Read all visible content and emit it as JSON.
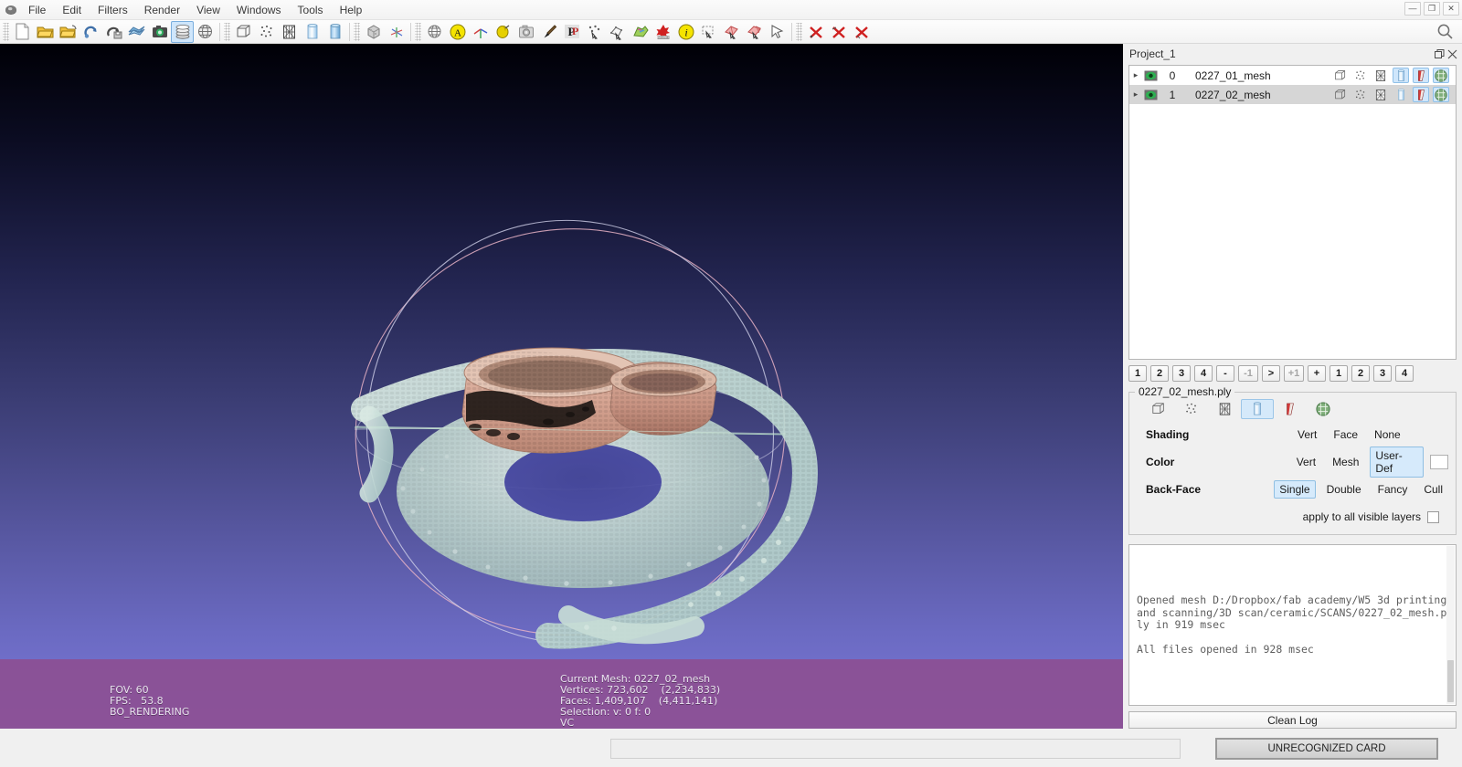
{
  "window": {
    "minimize_label": "—",
    "restore_label": "❐",
    "close_label": "✕"
  },
  "menubar": {
    "app_icon": "meshlab-logo-icon",
    "items": [
      {
        "label": "File"
      },
      {
        "label": "Edit"
      },
      {
        "label": "Filters"
      },
      {
        "label": "Render"
      },
      {
        "label": "View"
      },
      {
        "label": "Windows"
      },
      {
        "label": "Tools"
      },
      {
        "label": "Help"
      }
    ]
  },
  "toolbar": {
    "groups": [
      {
        "buttons": [
          {
            "icon": "new-document-icon",
            "active": false
          },
          {
            "icon": "open-project-folder-icon",
            "active": false
          },
          {
            "icon": "open-mesh-folder-icon",
            "active": false
          },
          {
            "icon": "reload-mesh-icon",
            "active": false
          },
          {
            "icon": "save-mesh-icon",
            "active": false
          },
          {
            "icon": "save-project-icon",
            "active": false
          },
          {
            "icon": "snapshot-camera-icon",
            "active": false
          },
          {
            "icon": "layer-stack-icon",
            "active": true
          },
          {
            "icon": "globe-align-icon",
            "active": false
          }
        ]
      },
      {
        "buttons": [
          {
            "icon": "bounding-box-icon",
            "active": false
          },
          {
            "icon": "point-cloud-icon",
            "active": false
          },
          {
            "icon": "wireframe-icon",
            "active": false
          },
          {
            "icon": "flat-lines-icon",
            "active": false
          },
          {
            "icon": "smooth-shading-icon",
            "active": false
          }
        ]
      },
      {
        "buttons": [
          {
            "icon": "texture-cube-icon",
            "active": false
          },
          {
            "icon": "xyz-axis-icon",
            "active": false
          }
        ]
      },
      {
        "buttons": [
          {
            "icon": "sphere-wireframe-icon",
            "active": false
          },
          {
            "icon": "align-tool-icon",
            "active": false
          },
          {
            "icon": "measure-axis-icon",
            "active": false
          },
          {
            "icon": "paint-bucket-icon",
            "active": false
          },
          {
            "icon": "render-camera-icon",
            "active": false
          },
          {
            "icon": "paint-brush-icon",
            "active": false
          },
          {
            "icon": "pp-points-icon",
            "active": false
          },
          {
            "icon": "point-select-icon",
            "active": false
          },
          {
            "icon": "edge-select-icon",
            "active": false
          },
          {
            "icon": "color-select-icon",
            "active": false
          },
          {
            "icon": "secret-star-icon",
            "active": false
          },
          {
            "icon": "info-icon",
            "active": false
          },
          {
            "icon": "select-rect-icon",
            "active": false
          },
          {
            "icon": "select-faces-icon",
            "active": false
          },
          {
            "icon": "select-connected-icon",
            "active": false
          },
          {
            "icon": "select-pointer-icon",
            "active": false
          }
        ]
      },
      {
        "buttons": [
          {
            "icon": "delete-selected-faces-icon",
            "active": false
          },
          {
            "icon": "delete-selected-vertices-icon",
            "active": false
          },
          {
            "icon": "clear-selection-icon",
            "active": false
          }
        ]
      }
    ],
    "search_icon": "search-icon"
  },
  "viewport": {
    "scene_description": "3d-scan-pointcloud-ceramic-baskets",
    "fov_label": "FOV: 60",
    "fps_label": "FPS:   53.8",
    "render_mode_label": "BO_RENDERING",
    "current_mesh_label": "Current Mesh: 0227_02_mesh",
    "vertices_label": "Vertices: 723,602    (2,234,833)",
    "faces_label": "Faces: 1,409,107    (4,411,141)",
    "selection_label": "Selection: v: 0 f: 0",
    "vc_label": "VC",
    "background_top": "#000006",
    "background_bottom": "#7b78d8",
    "band_color": "#8d4d90",
    "mesh_colors": {
      "cloud": "#cbdfd9",
      "basket": "#d9aa9b",
      "basket_dark": "#1a1410",
      "trackball_x": "#e8b3c6",
      "trackball_y": "#b9e2c9",
      "trackball_z": "#cfd0e8"
    }
  },
  "dock": {
    "title": "Project_1",
    "float_icon": "undock-icon",
    "close_icon": "close-icon",
    "layers": [
      {
        "expand_icon": "chevron-right-icon",
        "visible_icon": "eye-visible-icon",
        "index": "0",
        "name": "0227_01_mesh",
        "selected": false,
        "icons": [
          {
            "icon": "bounding-box-icon",
            "on": false
          },
          {
            "icon": "point-cloud-icon",
            "on": false
          },
          {
            "icon": "wireframe-icon",
            "on": false
          },
          {
            "icon": "flat-lines-icon",
            "on": true
          },
          {
            "icon": "smooth-shading-icon",
            "on": true
          },
          {
            "icon": "texture-icon",
            "on": true
          }
        ]
      },
      {
        "expand_icon": "chevron-right-icon",
        "visible_icon": "eye-visible-icon",
        "index": "1",
        "name": "0227_02_mesh",
        "selected": true,
        "icons": [
          {
            "icon": "bounding-box-icon",
            "on": false
          },
          {
            "icon": "point-cloud-icon",
            "on": false
          },
          {
            "icon": "wireframe-icon",
            "on": false
          },
          {
            "icon": "flat-lines-icon",
            "on": false
          },
          {
            "icon": "smooth-shading-icon",
            "on": true
          },
          {
            "icon": "texture-icon",
            "on": true
          }
        ]
      }
    ],
    "number_buttons": [
      {
        "label": "1",
        "style": "normal"
      },
      {
        "label": "2",
        "style": "normal"
      },
      {
        "label": "3",
        "style": "normal"
      },
      {
        "label": "4",
        "style": "normal"
      },
      {
        "label": "-",
        "style": "normal"
      },
      {
        "label": "-1",
        "style": "dim"
      },
      {
        "label": ">",
        "style": "normal"
      },
      {
        "label": "+1",
        "style": "dim"
      },
      {
        "label": "+",
        "style": "normal"
      },
      {
        "label": "1",
        "style": "normal"
      },
      {
        "label": "2",
        "style": "normal"
      },
      {
        "label": "3",
        "style": "normal"
      },
      {
        "label": "4",
        "style": "normal"
      }
    ],
    "render_group_title": "0227_02_mesh.ply",
    "render_modes": [
      {
        "icon": "bounding-box-icon",
        "on": false
      },
      {
        "icon": "point-cloud-icon",
        "on": false
      },
      {
        "icon": "wireframe-icon",
        "on": false
      },
      {
        "icon": "flat-lines-icon",
        "on": true
      },
      {
        "icon": "smooth-shading-icon",
        "on": false
      },
      {
        "icon": "texture-icon",
        "on": false
      }
    ],
    "properties": [
      {
        "label": "Shading",
        "options": [
          {
            "label": "Vert",
            "on": false
          },
          {
            "label": "Face",
            "on": false
          },
          {
            "label": "None",
            "on": false
          }
        ],
        "swatch": false
      },
      {
        "label": "Color",
        "options": [
          {
            "label": "Vert",
            "on": false
          },
          {
            "label": "Mesh",
            "on": false
          },
          {
            "label": "User-Def",
            "on": true
          }
        ],
        "swatch": true,
        "swatch_color": "#ffffff"
      },
      {
        "label": "Back-Face",
        "options": [
          {
            "label": "Single",
            "on": true
          },
          {
            "label": "Double",
            "on": false
          },
          {
            "label": "Fancy",
            "on": false
          },
          {
            "label": "Cull",
            "on": false
          }
        ],
        "swatch": false
      }
    ],
    "apply_all_label": "apply to all visible layers",
    "apply_all_checked": false,
    "log_lines": [
      "Opened mesh D:/Dropbox/fab academy/W5 3d printing and scanning/3D scan/ceramic/SCANS/0227_02_mesh.ply in 919 msec",
      "All files opened in 928 msec"
    ],
    "clean_log_label": "Clean Log"
  },
  "statusbar": {
    "progress_value": "",
    "card_label": "UNRECOGNIZED CARD"
  }
}
